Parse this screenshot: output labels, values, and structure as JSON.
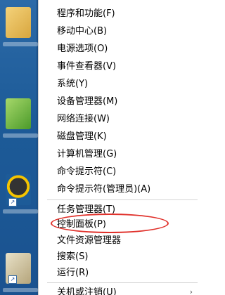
{
  "context_menu": {
    "items": [
      {
        "label": "程序和功能(F)"
      },
      {
        "label": "移动中心(B)"
      },
      {
        "label": "电源选项(O)"
      },
      {
        "label": "事件查看器(V)"
      },
      {
        "label": "系统(Y)"
      },
      {
        "label": "设备管理器(M)"
      },
      {
        "label": "网络连接(W)"
      },
      {
        "label": "磁盘管理(K)"
      },
      {
        "label": "计算机管理(G)"
      },
      {
        "label": "命令提示符(C)"
      },
      {
        "label": "命令提示符(管理员)(A)"
      },
      {
        "label": "任务管理器(T)"
      },
      {
        "label": "控制面板(P)"
      },
      {
        "label": "文件资源管理器"
      },
      {
        "label": "搜索(S)"
      },
      {
        "label": "运行(R)"
      },
      {
        "label": "关机或注销(U)"
      }
    ],
    "highlighted_item": "控制面板(P)",
    "highlight_color": "#e0302a",
    "submenu_arrow_icon": "chevron-right-icon"
  },
  "desktop": {
    "icons": [
      {
        "name": "folder-user-icon"
      },
      {
        "name": "app-green-icon"
      },
      {
        "name": "qq-icon"
      },
      {
        "name": "photo-icon"
      }
    ]
  }
}
